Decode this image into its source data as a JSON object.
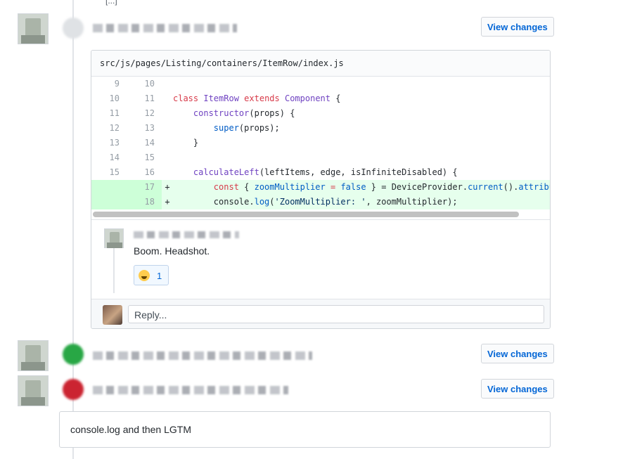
{
  "top_fragment": "[...]",
  "events": [
    {
      "view_label": "View changes"
    },
    {
      "view_label": "View changes"
    },
    {
      "view_label": "View changes"
    }
  ],
  "file": {
    "path": "src/js/pages/Listing/containers/ItemRow/index.js",
    "lines": [
      {
        "old": "9",
        "new": "10",
        "sign": " ",
        "type": "ctx"
      },
      {
        "old": "10",
        "new": "11",
        "sign": " ",
        "type": "ctx"
      },
      {
        "old": "11",
        "new": "12",
        "sign": " ",
        "type": "ctx"
      },
      {
        "old": "12",
        "new": "13",
        "sign": " ",
        "type": "ctx"
      },
      {
        "old": "13",
        "new": "14",
        "sign": " ",
        "type": "ctx"
      },
      {
        "old": "14",
        "new": "15",
        "sign": " ",
        "type": "ctx"
      },
      {
        "old": "15",
        "new": "16",
        "sign": " ",
        "type": "ctx"
      },
      {
        "old": "",
        "new": "17",
        "sign": "+",
        "type": "add"
      },
      {
        "old": "",
        "new": "18",
        "sign": "+",
        "type": "add"
      }
    ],
    "code": {
      "l2": {
        "kw1": "class",
        "name": "ItemRow",
        "kw2": "extends",
        "base": "Component",
        "tail": " {"
      },
      "l3": {
        "fn": "constructor",
        "tail": "(props) {"
      },
      "l4": {
        "fn": "super",
        "tail": "(props);"
      },
      "l5": "    }",
      "l7": {
        "fn": "calculateLeft",
        "tail": "(leftItems, edge, isInfiniteDisabled) {"
      },
      "l8": {
        "kw": "const",
        "a": " { ",
        "var": "zoomMultiplier",
        "eq": " = ",
        "val": "false",
        "b": " } = DeviceProvider.",
        "m1": "current",
        "c": "().",
        "m2": "attributes"
      },
      "l9": {
        "a": "console.",
        "fn": "log",
        "b": "(",
        "str": "'ZoomMultiplier: '",
        "c": ", zoomMultiplier);"
      }
    }
  },
  "comment": {
    "text": "Boom. Headshot.",
    "reaction_count": "1"
  },
  "reply": {
    "placeholder": "Reply..."
  },
  "review": {
    "text": "console.log and then LGTM"
  },
  "colors": {
    "approve": "#28a745",
    "changes": "#cb2431",
    "link": "#0366d6"
  }
}
